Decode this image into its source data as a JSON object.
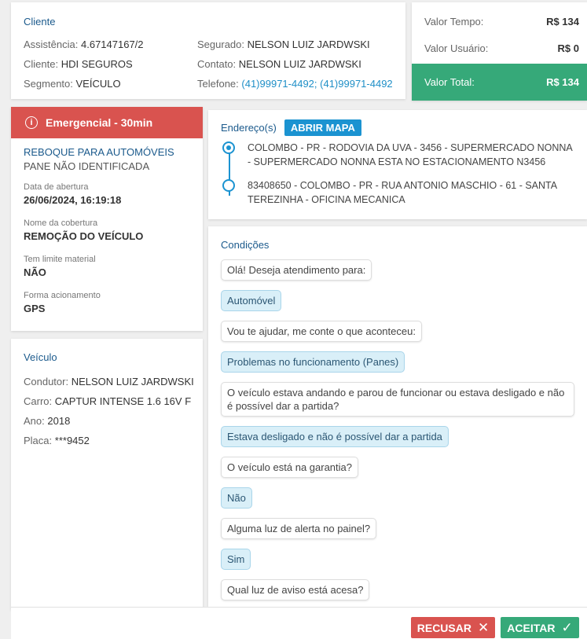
{
  "cliente": {
    "title": "Cliente",
    "assistencia_label": "Assistência:",
    "assistencia": "4.67147167/2",
    "cliente_label": "Cliente:",
    "cliente": "HDI SEGUROS",
    "segmento_label": "Segmento:",
    "segmento": "VEÍCULO",
    "segurado_label": "Segurado:",
    "segurado": "NELSON LUIZ JARDWSKI",
    "contato_label": "Contato:",
    "contato": "NELSON LUIZ JARDWSKI",
    "telefone_label": "Telefone:",
    "telefone": "(41)99971-4492; (41)99971-4492"
  },
  "valores": {
    "tempo_label": "Valor Tempo:",
    "tempo": "R$ 134",
    "usuario_label": "Valor Usuário:",
    "usuario": "R$ 0",
    "total_label": "Valor Total:",
    "total": "R$ 134",
    "total_color": "#36a979"
  },
  "emergencial": {
    "header": "Emergencial - 30min",
    "header_color": "#d9534f",
    "servico": "REBOQUE PARA AUTOMÓVEIS",
    "subservico": "PANE NÃO IDENTIFICADA",
    "abertura_label": "Data de abertura",
    "abertura": "26/06/2024, 16:19:18",
    "cobertura_label": "Nome da cobertura",
    "cobertura": "REMOÇÃO DO VEÍCULO",
    "limite_label": "Tem limite material",
    "limite": "NÃO",
    "acionamento_label": "Forma acionamento",
    "acionamento": "GPS"
  },
  "veiculo": {
    "title": "Veículo",
    "condutor_label": "Condutor:",
    "condutor": "NELSON LUIZ JARDWSKI",
    "carro_label": "Carro:",
    "carro": "CAPTUR INTENSE 1.6 16V F",
    "ano_label": "Ano:",
    "ano": "2018",
    "placa_label": "Placa:",
    "placa": "***9452"
  },
  "endereco": {
    "label": "Endereço(s)",
    "open_map": "ABRIR MAPA",
    "addresses": [
      "COLOMBO - PR - RODOVIA DA UVA - 3456 - SUPERMERCADO NONNA - SUPERMERCADO NONNA ESTA NO ESTACIONAMENTO N3456",
      "83408650 - COLOMBO - PR - RUA ANTONIO MASCHIO - 61 - SANTA TEREZINHA - OFICINA MECANICA"
    ]
  },
  "condicoes": {
    "title": "Condições",
    "messages": [
      {
        "type": "q",
        "text": "Olá! Deseja atendimento para:"
      },
      {
        "type": "a",
        "text": "Automóvel"
      },
      {
        "type": "q",
        "text": "Vou te ajudar, me conte o que aconteceu:"
      },
      {
        "type": "a",
        "text": "Problemas no funcionamento (Panes)"
      },
      {
        "type": "q",
        "text": "O veículo estava andando e parou de funcionar ou estava desligado e não é possível dar a partida?"
      },
      {
        "type": "a",
        "text": "Estava desligado e não é possível dar a partida"
      },
      {
        "type": "q",
        "text": "O veículo está na garantia?"
      },
      {
        "type": "a",
        "text": "Não"
      },
      {
        "type": "q",
        "text": "Alguma luz de alerta no painel?"
      },
      {
        "type": "a",
        "text": "Sim"
      },
      {
        "type": "q",
        "text": "Qual luz de aviso está acesa?"
      }
    ]
  },
  "footer": {
    "recusar": "RECUSAR",
    "aceitar": "ACEITAR",
    "recusar_icon": "close-icon",
    "aceitar_icon": "check-icon"
  }
}
